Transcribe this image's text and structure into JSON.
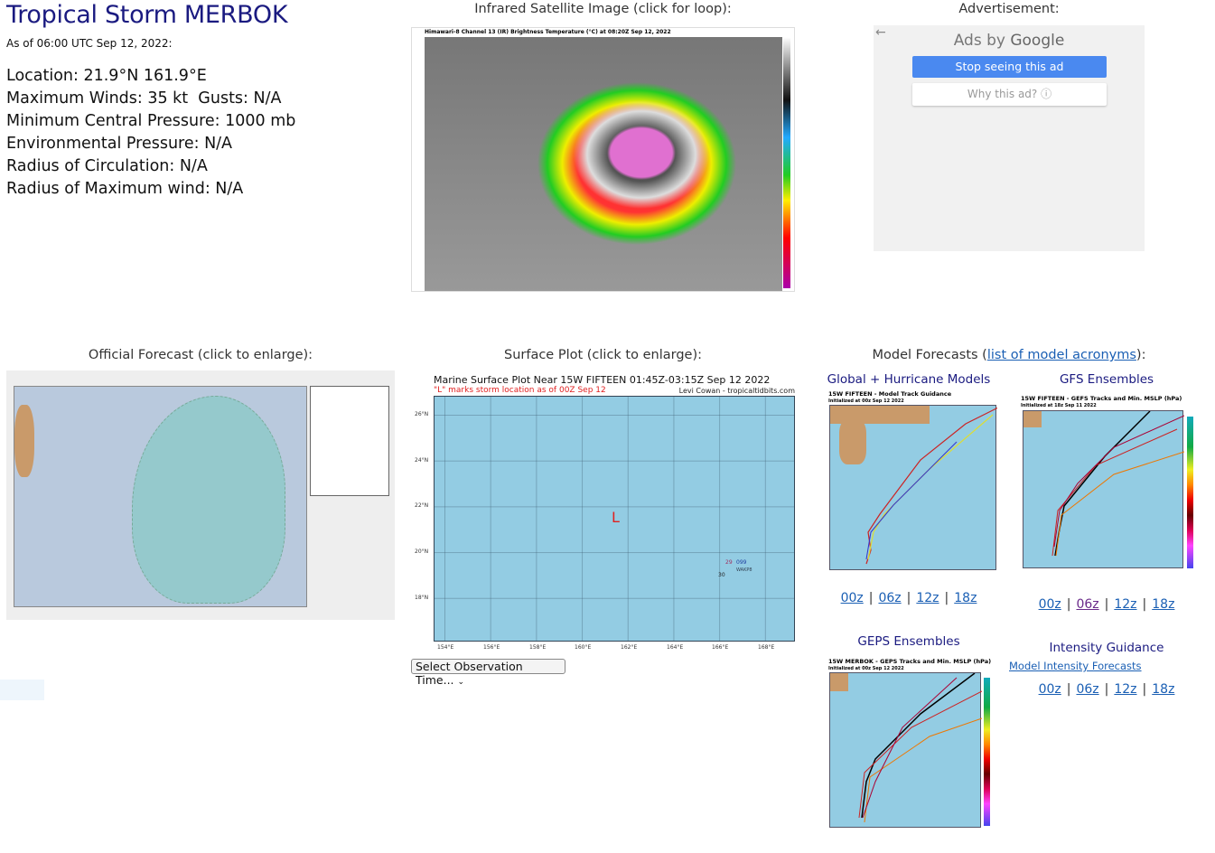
{
  "storm": {
    "title": "Tropical Storm MERBOK",
    "as_of": "As of 06:00 UTC Sep 12, 2022:",
    "details": [
      "Location: 21.9°N 161.9°E",
      "Maximum Winds: 35 kt  Gusts: N/A",
      "Minimum Central Pressure: 1000 mb",
      "Environmental Pressure: N/A",
      "Radius of Circulation: N/A",
      "Radius of Maximum wind: N/A"
    ]
  },
  "satellite": {
    "header": "Infrared Satellite Image (click for loop):",
    "image_title": "Himawari-8 Channel 13 (IR) Brightness Temperature (°C) at 08:20Z Sep 12, 2022"
  },
  "ad": {
    "header": "Advertisement:",
    "back_icon": "arrow-left-icon",
    "ads_by": "Ads by",
    "google": "Google",
    "stop_label": "Stop seeing this ad",
    "why_label": "Why this ad? ⓘ",
    "button_color": "#4a89f0"
  },
  "official": {
    "header": "Official Forecast (click to enlarge):"
  },
  "surface": {
    "header": "Surface Plot (click to enlarge):",
    "plot_title": "Marine Surface Plot Near 15W FIFTEEN 01:45Z-03:15Z Sep 12 2022",
    "plot_subtitle": "\"L\" marks storm location as of 00Z Sep 12",
    "credit": "Levi Cowan - tropicaltidbits.com",
    "storm_marker": "L",
    "lat_ticks": [
      "26°N",
      "24°N",
      "22°N",
      "20°N",
      "18°N"
    ],
    "lon_ticks": [
      "154°E",
      "156°E",
      "158°E",
      "160°E",
      "162°E",
      "164°E",
      "166°E",
      "168°E"
    ],
    "obs": {
      "temp": "29",
      "pressure": "099",
      "dew": "30",
      "id": "WAKP8"
    },
    "select_label": "Select Observation Time..."
  },
  "models": {
    "header_prefix": "Model Forecasts (",
    "header_link": "list of model acronyms",
    "header_suffix": "):",
    "global": {
      "header": "Global + Hurricane Models",
      "image_title": "15W FIFTEEN - Model Track Guidance",
      "image_sub": "Initialized at 00z Sep 12 2022",
      "links": [
        "00z",
        "06z",
        "12z",
        "18z"
      ]
    },
    "gfs": {
      "header": "GFS Ensembles",
      "image_title": "15W FIFTEEN - GEFS Tracks and Min. MSLP (hPa)",
      "image_sub": "Initialized at 18z Sep 11 2022",
      "links": [
        "00z",
        "06z",
        "12z",
        "18z"
      ]
    },
    "geps": {
      "header": "GEPS Ensembles",
      "image_title": "15W MERBOK - GEPS Tracks and Min. MSLP (hPa)",
      "image_sub": "Initialized at 00z Sep 12 2022"
    },
    "intensity": {
      "header": "Intensity Guidance",
      "link": "Model Intensity Forecasts",
      "links": [
        "00z",
        "06z",
        "12z",
        "18z"
      ]
    },
    "separator": "|"
  }
}
